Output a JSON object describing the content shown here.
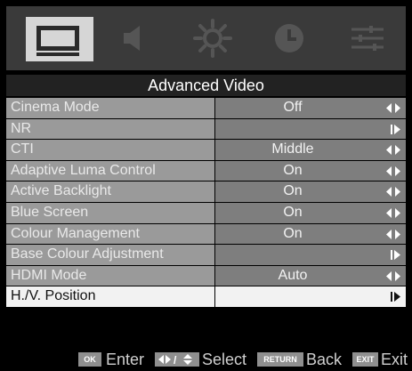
{
  "menu": {
    "icons": [
      {
        "name": "picture-icon",
        "selected": true
      },
      {
        "name": "sound-icon",
        "selected": false
      },
      {
        "name": "settings-icon",
        "selected": false
      },
      {
        "name": "timer-icon",
        "selected": false
      },
      {
        "name": "setup-icon",
        "selected": false
      }
    ],
    "title": "Advanced Video",
    "items": [
      {
        "label": "Cinema Mode",
        "value": "Off",
        "arrows": "both"
      },
      {
        "label": "NR",
        "value": "",
        "arrows": "right"
      },
      {
        "label": "CTI",
        "value": "Middle",
        "arrows": "both"
      },
      {
        "label": "Adaptive Luma Control",
        "value": "On",
        "arrows": "both"
      },
      {
        "label": "Active Backlight",
        "value": "On",
        "arrows": "both"
      },
      {
        "label": "Blue Screen",
        "value": "On",
        "arrows": "both"
      },
      {
        "label": "Colour Management",
        "value": "On",
        "arrows": "both"
      },
      {
        "label": "Base Colour Adjustment",
        "value": "",
        "arrows": "right"
      },
      {
        "label": "HDMI Mode",
        "value": "Auto",
        "arrows": "both"
      },
      {
        "label": "H./V. Position",
        "value": "",
        "arrows": "right",
        "selected": true
      }
    ]
  },
  "footer": {
    "ok_key": "OK",
    "enter_label": "Enter",
    "select_label": "Select",
    "return_key": "RETURN",
    "back_label": "Back",
    "exit_key": "EXIT",
    "exit_label": "Exit"
  },
  "colors": {
    "label_bg": "#9a9a9a",
    "value_bg": "#7e7e7e",
    "selected_bg": "#f2f2f2",
    "iconbar_bg": "#3a3a3a",
    "title_bg": "#222222"
  }
}
